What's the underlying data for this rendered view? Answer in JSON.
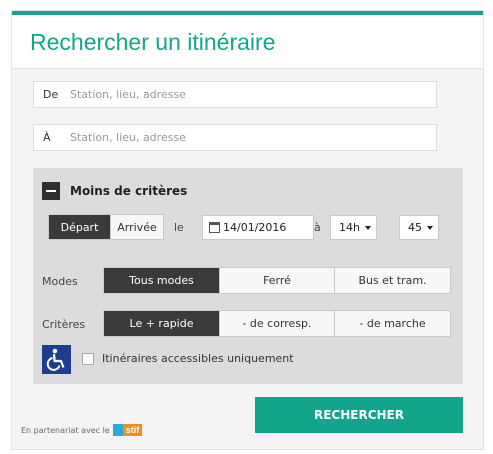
{
  "header": {
    "title": "Rechercher un itinéraire"
  },
  "colors": {
    "accent": "#12a58c",
    "accessibility_icon": "#1d3d8f",
    "partner_logo": "#f28c1a"
  },
  "from_field": {
    "prefix": "De",
    "placeholder": "Station, lieu, adresse",
    "value": ""
  },
  "to_field": {
    "prefix": "À",
    "placeholder": "Station, lieu, adresse",
    "value": ""
  },
  "criteria": {
    "toggle_label": "Moins de critères",
    "toggle_icon": "minus-icon",
    "timing": {
      "options": [
        "Départ",
        "Arrivée"
      ],
      "selected": "Départ"
    },
    "date_label": "le",
    "date_value": "14/01/2016",
    "time_label": "à",
    "hour": "14h",
    "minute": "45",
    "modes": {
      "label": "Modes",
      "options": [
        "Tous modes",
        "Ferré",
        "Bus et tram."
      ],
      "selected": "Tous modes"
    },
    "preferences": {
      "label": "Critères",
      "options": [
        "Le + rapide",
        "- de corresp.",
        "- de marche"
      ],
      "selected": "Le + rapide"
    },
    "accessible_label": "Itinéraires accessibles uniquement",
    "accessible_checked": false,
    "accessible_icon": "wheelchair-icon"
  },
  "submit_label": "RECHERCHER",
  "partner": {
    "text": "En partenariat avec le",
    "logo_text": "stif"
  }
}
